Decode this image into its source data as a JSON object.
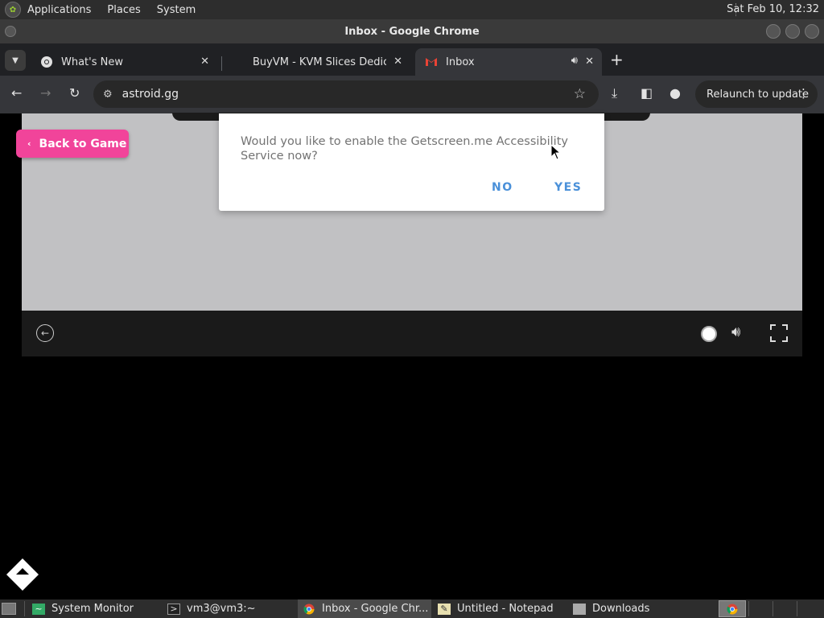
{
  "system_bar": {
    "menus": [
      "Applications",
      "Places",
      "System"
    ],
    "clock": "Sat Feb 10, 12:32"
  },
  "window": {
    "title": "Inbox - Google Chrome"
  },
  "tabs": [
    {
      "title": "What's New",
      "icon": "chrome-icon"
    },
    {
      "title": "BuyVM - KVM Slices Dedicated",
      "icon": "blank-page-icon"
    },
    {
      "title": "Inbox",
      "icon": "gmail-icon",
      "audio": true
    }
  ],
  "toolbar": {
    "url": "astroid.gg",
    "relaunch_label": "Relaunch to update"
  },
  "page": {
    "back_button_label": "Back to Game",
    "dialog": {
      "message": "Would you like to enable the Getscreen.me Accessibility Service now?",
      "no_label": "NO",
      "yes_label": "YES"
    }
  },
  "taskbar": {
    "items": [
      {
        "label": "System Monitor",
        "icon": "system-monitor-icon"
      },
      {
        "label": "vm3@vm3:~",
        "icon": "terminal-icon"
      },
      {
        "label": "Inbox - Google Chr...",
        "icon": "chrome-icon",
        "active": true
      },
      {
        "label": "Untitled - Notepad",
        "icon": "notepad-icon"
      },
      {
        "label": "Downloads",
        "icon": "folder-icon"
      }
    ]
  },
  "colors": {
    "accent_pink": "#f1449a",
    "dialog_button_blue": "#4a90d9",
    "game_background": "#c1c1c3"
  }
}
